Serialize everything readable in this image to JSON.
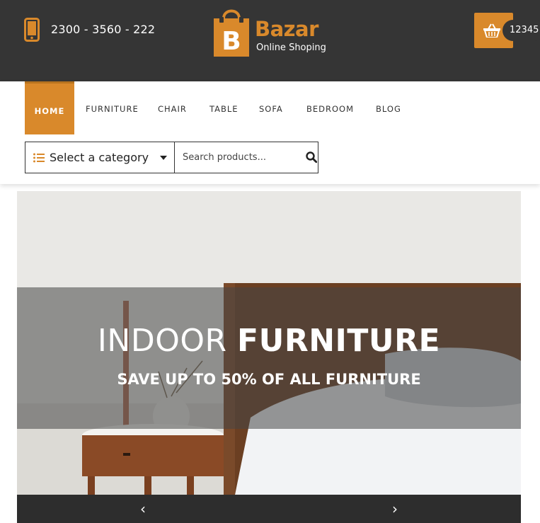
{
  "header": {
    "phone_number": "2300 - 3560 - 222",
    "logo": {
      "letter": "B",
      "word": "Bazar",
      "tagline": "Online Shoping"
    },
    "cart_count": "12345",
    "phone_icon": "phone-icon",
    "cart_icon": "basket-icon"
  },
  "nav": {
    "items": [
      {
        "label": "HOME",
        "active": true
      },
      {
        "label": "FURNITURE"
      },
      {
        "label": "CHAIR"
      },
      {
        "label": "TABLE"
      },
      {
        "label": "SOFA"
      },
      {
        "label": "BEDROOM"
      },
      {
        "label": "BLOG"
      }
    ]
  },
  "search": {
    "category_label": "Select a category",
    "placeholder": "Search products..."
  },
  "hero": {
    "title_light": "INDOOR ",
    "title_bold": "FURNITURE",
    "subtitle": "SAVE UP TO 50% OF ALL FURNITURE",
    "prev_arrow": "‹",
    "next_arrow": "›"
  },
  "colors": {
    "accent": "#d9892b",
    "header_bg": "#353535",
    "slider_bar": "#2d2d2d"
  }
}
